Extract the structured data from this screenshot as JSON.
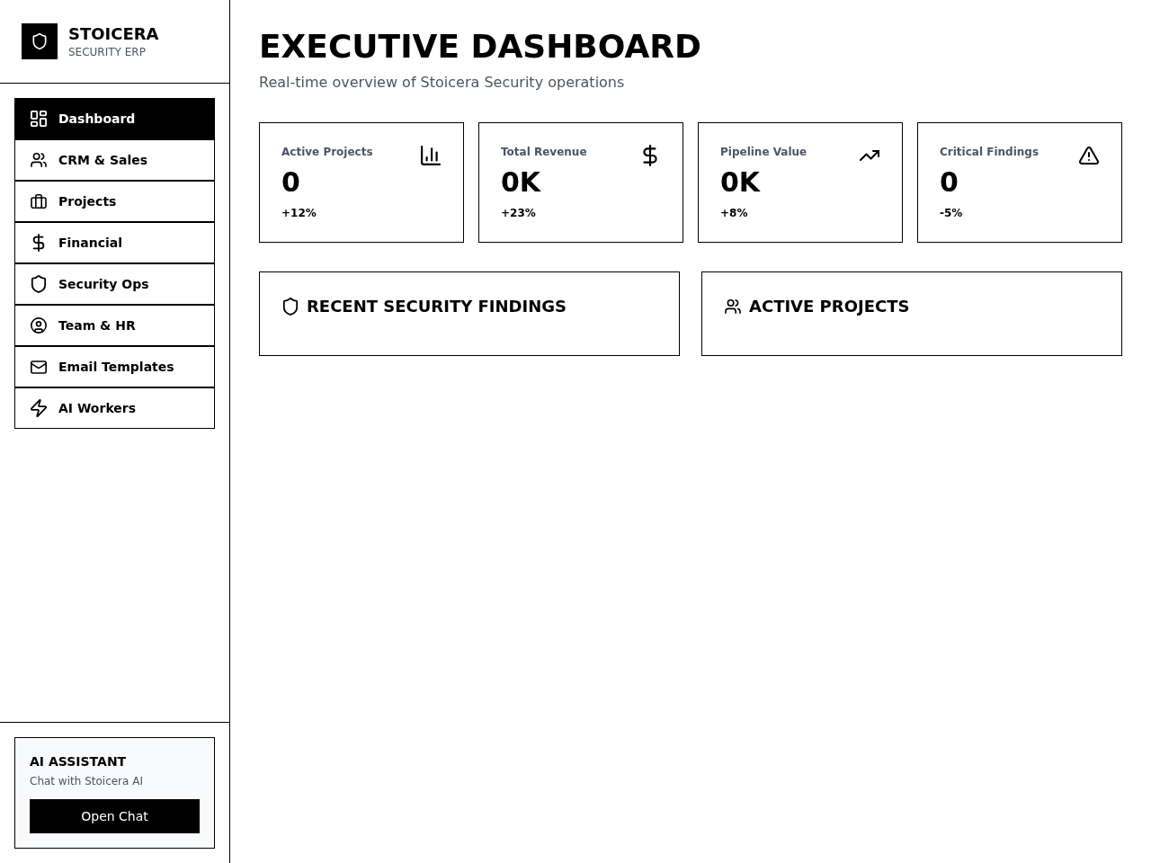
{
  "sidebar": {
    "brand": {
      "name": "STOICERA",
      "tagline": "SECURITY ERP"
    },
    "nav_items": [
      {
        "label": "Dashboard",
        "selected": true
      },
      {
        "label": "CRM & Sales",
        "selected": false
      },
      {
        "label": "Projects",
        "selected": false
      },
      {
        "label": "Financial",
        "selected": false
      },
      {
        "label": "Security Ops",
        "selected": false
      },
      {
        "label": "Team & HR",
        "selected": false
      },
      {
        "label": "Email Templates",
        "selected": false
      },
      {
        "label": "AI Workers",
        "selected": false
      }
    ],
    "assistant": {
      "title": "AI ASSISTANT",
      "subtitle": "Chat with Stoicera AI",
      "button": "Open Chat"
    }
  },
  "header": {
    "title": "EXECUTIVE DASHBOARD",
    "subtitle": "Real-time overview of Stoicera Security operations"
  },
  "stats": [
    {
      "label": "Active Projects",
      "value": "0",
      "change": "+12%"
    },
    {
      "label": "Total Revenue",
      "value": "0K",
      "change": "+23%"
    },
    {
      "label": "Pipeline Value",
      "value": "0K",
      "change": "+8%"
    },
    {
      "label": "Critical Findings",
      "value": "0",
      "change": "-5%"
    }
  ],
  "panels": [
    {
      "title": "RECENT SECURITY FINDINGS"
    },
    {
      "title": "ACTIVE PROJECTS"
    }
  ]
}
